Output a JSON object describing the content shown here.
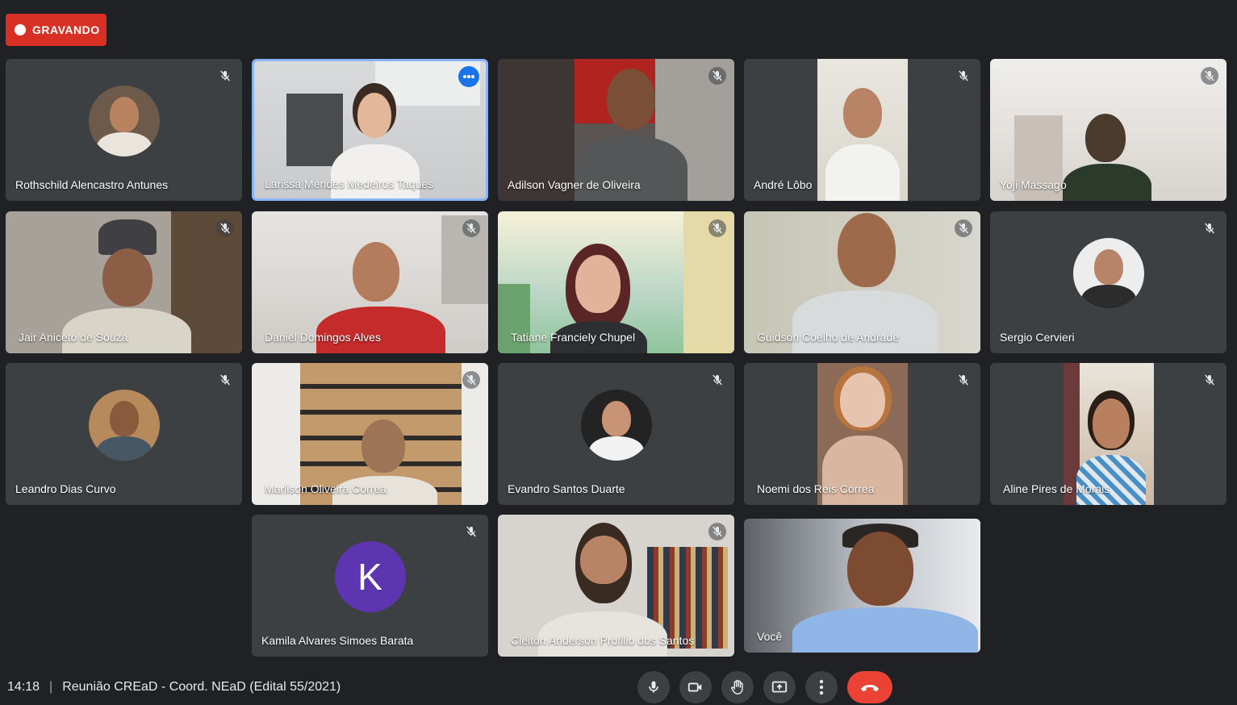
{
  "recording": {
    "label": "GRAVANDO",
    "color": "#d93025"
  },
  "meeting": {
    "time": "14:18",
    "separator": "|",
    "title": "Reunião CREaD - Coord. NEaD (Edital 55/2021)"
  },
  "participants": [
    {
      "name": "Rothschild Alencastro Antunes",
      "mode": "avatar",
      "mic_icon": "mic-off-icon"
    },
    {
      "name": "Larissa Mendes Medeiros Taques",
      "mode": "video",
      "active_speaker": true,
      "menu_icon": "more-options-icon"
    },
    {
      "name": "Adilson Vagner de Oliveira",
      "mode": "video",
      "mic_icon": "mic-off-icon"
    },
    {
      "name": "André Lôbo",
      "mode": "video",
      "mic_icon": "mic-off-icon"
    },
    {
      "name": "Yoji Massago",
      "mode": "video",
      "mic_icon": "mic-off-icon"
    },
    {
      "name": "Jair Aniceto de Souza",
      "mode": "video",
      "mic_icon": "mic-off-icon"
    },
    {
      "name": "Daniel Domingos Alves",
      "mode": "video",
      "mic_icon": "mic-off-icon"
    },
    {
      "name": "Tatiane Franciely Chupel",
      "mode": "video",
      "mic_icon": "mic-off-icon"
    },
    {
      "name": "Guidson Coelho de Andrade",
      "mode": "video",
      "mic_icon": "mic-off-icon"
    },
    {
      "name": "Sergio Cervieri",
      "mode": "avatar",
      "mic_icon": "mic-off-icon"
    },
    {
      "name": "Leandro Dias Curvo",
      "mode": "avatar",
      "mic_icon": "mic-off-icon"
    },
    {
      "name": "Marlison Oliveira Correa",
      "mode": "video",
      "mic_icon": "mic-off-icon"
    },
    {
      "name": "Evandro Santos Duarte",
      "mode": "avatar",
      "mic_icon": "mic-off-icon"
    },
    {
      "name": "Noemi dos Reis Correa",
      "mode": "video",
      "mic_icon": "mic-off-icon"
    },
    {
      "name": "Aline Pires de Morais",
      "mode": "video",
      "mic_icon": "mic-off-icon"
    },
    {
      "name": "Kamila Alvares Simoes Barata",
      "mode": "letter",
      "letter": "K",
      "letter_color": "#5e35b1",
      "mic_icon": "mic-off-icon"
    },
    {
      "name": "Cleiton Anderson Profilio dos Santos",
      "mode": "video",
      "mic_icon": "mic-off-icon"
    },
    {
      "name": "Você",
      "mode": "video"
    }
  ],
  "controls": {
    "mic": "microphone-icon",
    "camera": "camera-icon",
    "raise_hand": "raise-hand-icon",
    "present": "present-screen-icon",
    "more": "more-vert-icon",
    "leave": "hang-up-icon",
    "leave_color": "#ea4335"
  }
}
